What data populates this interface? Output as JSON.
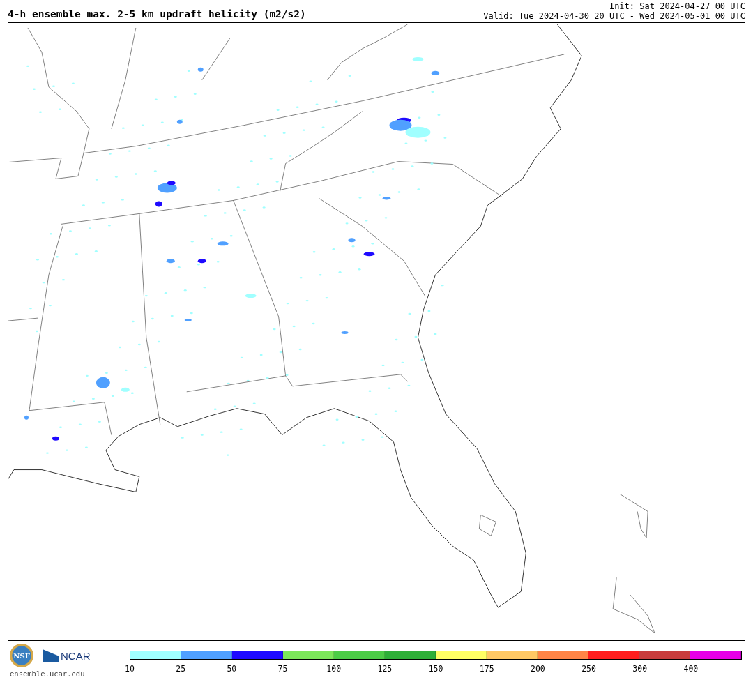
{
  "title": "4-h ensemble max. 2-5 km updraft helicity (m2/s2)",
  "init": "Init: Sat 2024-04-27 00 UTC",
  "valid": "Valid: Tue 2024-04-30 20 UTC - Wed 2024-05-01 00 UTC",
  "nsf_logo": "NSF",
  "ncar_logo": "NCAR",
  "site": "ensemble.ucar.edu",
  "legend": [
    {
      "color": "#a0ffff",
      "label": "10"
    },
    {
      "color": "#50a0ff",
      "label": "25"
    },
    {
      "color": "#1e0aff",
      "label": "50"
    },
    {
      "color": "#7ce65a",
      "label": "75"
    },
    {
      "color": "#4ccc46",
      "label": "100"
    },
    {
      "color": "#2eaf38",
      "label": "125"
    },
    {
      "color": "#ffff64",
      "label": "150"
    },
    {
      "color": "#ffc864",
      "label": "175"
    },
    {
      "color": "#ff8446",
      "label": "200"
    },
    {
      "color": "#ff1e1e",
      "label": "250"
    },
    {
      "color": "#c83c3c",
      "label": "300"
    },
    {
      "color": "#e600e6",
      "label": "400"
    }
  ]
}
